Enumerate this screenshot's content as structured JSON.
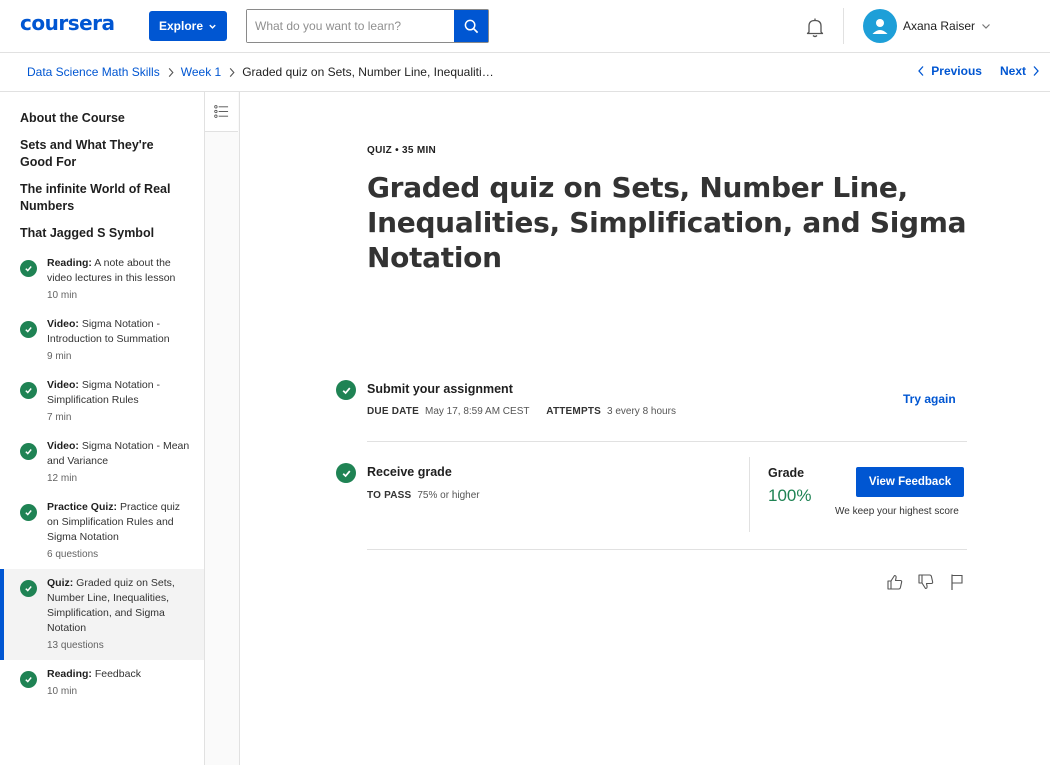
{
  "header": {
    "logo": "coursera",
    "explore_label": "Explore",
    "search_placeholder": "What do you want to learn?",
    "user_name": "Axana Raiser"
  },
  "breadcrumb": {
    "items": [
      "Data Science Math Skills",
      "Week 1"
    ],
    "current": "Graded quiz on Sets, Number Line, Inequalities, Simplification, and Sigma Notation",
    "previous_label": "Previous",
    "next_label": "Next"
  },
  "sidebar": {
    "sections": [
      "About the Course",
      "Sets and What They're Good For",
      "The infinite World of Real Numbers",
      "That Jagged S Symbol"
    ],
    "items": [
      {
        "type": "Reading:",
        "title": "A note about the video lectures in this lesson",
        "meta": "10 min"
      },
      {
        "type": "Video:",
        "title": "Sigma Notation - Introduction to Summation",
        "meta": "9 min"
      },
      {
        "type": "Video:",
        "title": "Sigma Notation - Simplification Rules",
        "meta": "7 min"
      },
      {
        "type": "Video:",
        "title": "Sigma Notation - Mean and Variance",
        "meta": "12 min"
      },
      {
        "type": "Practice Quiz:",
        "title": "Practice quiz on Simplification Rules and Sigma Notation",
        "meta": "6 questions"
      },
      {
        "type": "Quiz:",
        "title": "Graded quiz on Sets, Number Line, Inequalities, Simplification, and Sigma Notation",
        "meta": "13 questions"
      },
      {
        "type": "Reading:",
        "title": "Feedback",
        "meta": "10 min"
      }
    ]
  },
  "main": {
    "meta": "QUIZ • 35 MIN",
    "title": "Graded quiz on Sets, Number Line, Inequalities, Simplification, and Sigma Notation",
    "submit": {
      "title": "Submit your assignment",
      "due_label": "DUE DATE",
      "due_value": "May 17, 8:59 AM CEST",
      "attempts_label": "ATTEMPTS",
      "attempts_value": "3 every 8 hours",
      "try_again": "Try again"
    },
    "grade": {
      "title": "Receive grade",
      "pass_label": "TO PASS",
      "pass_value": "75% or higher",
      "grade_label": "Grade",
      "grade_value": "100%",
      "view_feedback": "View Feedback",
      "note": "We keep your highest score"
    }
  },
  "colors": {
    "brand_blue": "#0056d2",
    "success_green": "#1f8354",
    "avatar_blue": "#1e9fd8"
  },
  "icons": [
    "search-icon",
    "chevron-down-icon",
    "bell-icon",
    "user-icon",
    "chevron-right-icon",
    "chevron-left-icon",
    "check-icon",
    "list-icon",
    "thumbs-up-icon",
    "thumbs-down-icon",
    "flag-icon"
  ]
}
